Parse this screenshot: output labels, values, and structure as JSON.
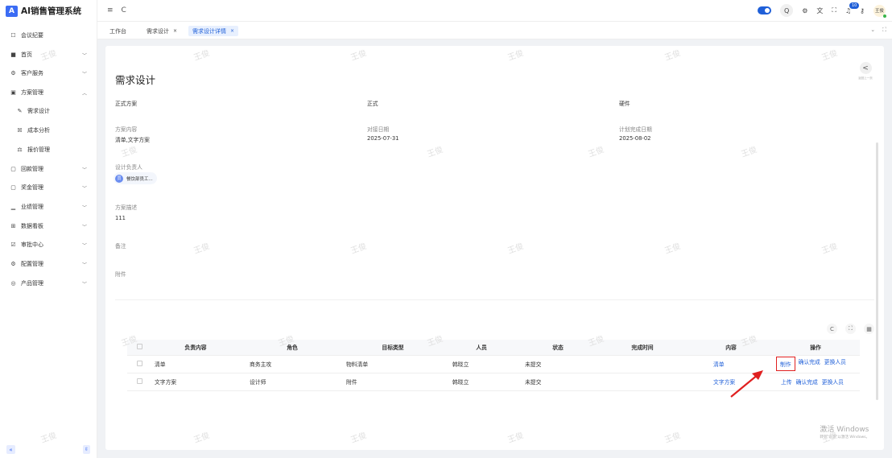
{
  "app": {
    "title": "AI销售管理系统",
    "logo_glyph": "A"
  },
  "sidebar": {
    "items": [
      {
        "label": "会议纪要",
        "icon": "meeting-icon",
        "glyph": "☐",
        "chevron": false
      },
      {
        "label": "首页",
        "icon": "home-grid-icon",
        "glyph": "■",
        "chevron": true
      },
      {
        "label": "客户服务",
        "icon": "service-icon",
        "glyph": "⚙",
        "chevron": true
      },
      {
        "label": "方案管理",
        "icon": "plan-icon",
        "glyph": "▣",
        "chevron": true,
        "expanded": true
      },
      {
        "label": "需求设计",
        "icon": "pen-icon",
        "glyph": "✎",
        "sub": true
      },
      {
        "label": "成本分析",
        "icon": "chart-icon",
        "glyph": "☒",
        "sub": true
      },
      {
        "label": "报价管理",
        "icon": "quote-icon",
        "glyph": "⚖",
        "sub": true
      },
      {
        "label": "回款管理",
        "icon": "payment-icon",
        "glyph": "▢",
        "chevron": true
      },
      {
        "label": "奖金管理",
        "icon": "bonus-icon",
        "glyph": "▢",
        "chevron": true
      },
      {
        "label": "业绩管理",
        "icon": "performance-icon",
        "glyph": "▁",
        "chevron": true
      },
      {
        "label": "数据看板",
        "icon": "dashboard-icon",
        "glyph": "⊞",
        "chevron": true
      },
      {
        "label": "审批中心",
        "icon": "approval-icon",
        "glyph": "☑",
        "chevron": true
      },
      {
        "label": "配置管理",
        "icon": "config-icon",
        "glyph": "⚙",
        "chevron": true
      },
      {
        "label": "产品管理",
        "icon": "product-icon",
        "glyph": "◎",
        "chevron": true
      }
    ],
    "collapse_glyph": "«",
    "pin_glyph": "⇳"
  },
  "topbar": {
    "menu_glyph": "≡",
    "refresh_glyph": "C",
    "search_glyph": "Q",
    "settings_glyph": "⚙",
    "translate_glyph": "文",
    "fullscreen_glyph": "⛶",
    "bell_glyph": "♫",
    "notification_count": "10",
    "key_glyph": "⚷",
    "user_initials": "王俊"
  },
  "tabs": [
    {
      "label": "工作台",
      "closable": false,
      "active": false
    },
    {
      "label": "需求设计",
      "closable": true,
      "active": false
    },
    {
      "label": "需求设计详情",
      "closable": true,
      "active": true
    }
  ],
  "tabs_right": {
    "dropdown": "⌄",
    "expand": "⛶"
  },
  "page": {
    "title": "需求设计",
    "back_label": "返回上一页",
    "back_glyph": "<",
    "row1": [
      "正式方案",
      "正式",
      "硬件"
    ],
    "fields": {
      "content_label": "方案内容",
      "content_value": "清单,文字方案",
      "docking_label": "对接日期",
      "docking_value": "2025-07-31",
      "plan_done_label": "计划完成日期",
      "plan_done_value": "2025-08-02",
      "owner_label": "设计负责人",
      "owner_value": "餐饮部员工...",
      "owner_glyph": "员",
      "desc_label": "方案描述",
      "desc_value": "111",
      "remark_label": "备注",
      "attach_label": "附件"
    }
  },
  "table_tools": {
    "refresh": "C",
    "fullscreen": "⛶",
    "columns": "▦"
  },
  "table": {
    "headers": [
      "",
      "负责内容",
      "角色",
      "目标类型",
      "人员",
      "状态",
      "完成时间",
      "内容",
      "操作"
    ],
    "rows": [
      {
        "content": "清单",
        "role": "商务主攻",
        "target": "物料清单",
        "person": "韩晓立",
        "status": "未提交",
        "done_time": "",
        "link": "清单",
        "ops": [
          "制作",
          "确认完成",
          "更换人员"
        ]
      },
      {
        "content": "文字方案",
        "role": "设计师",
        "target": "附件",
        "person": "韩晓立",
        "status": "未提交",
        "done_time": "",
        "link": "文字方案",
        "ops": [
          "上传",
          "确认完成",
          "更换人员"
        ]
      }
    ]
  },
  "watermark": "王俊",
  "windows_activation": {
    "title": "激活 Windows",
    "subtitle": "转到\"设置\"以激活 Windows。"
  },
  "colors": {
    "accent": "#1f5fd8",
    "highlight": "#e02020"
  }
}
